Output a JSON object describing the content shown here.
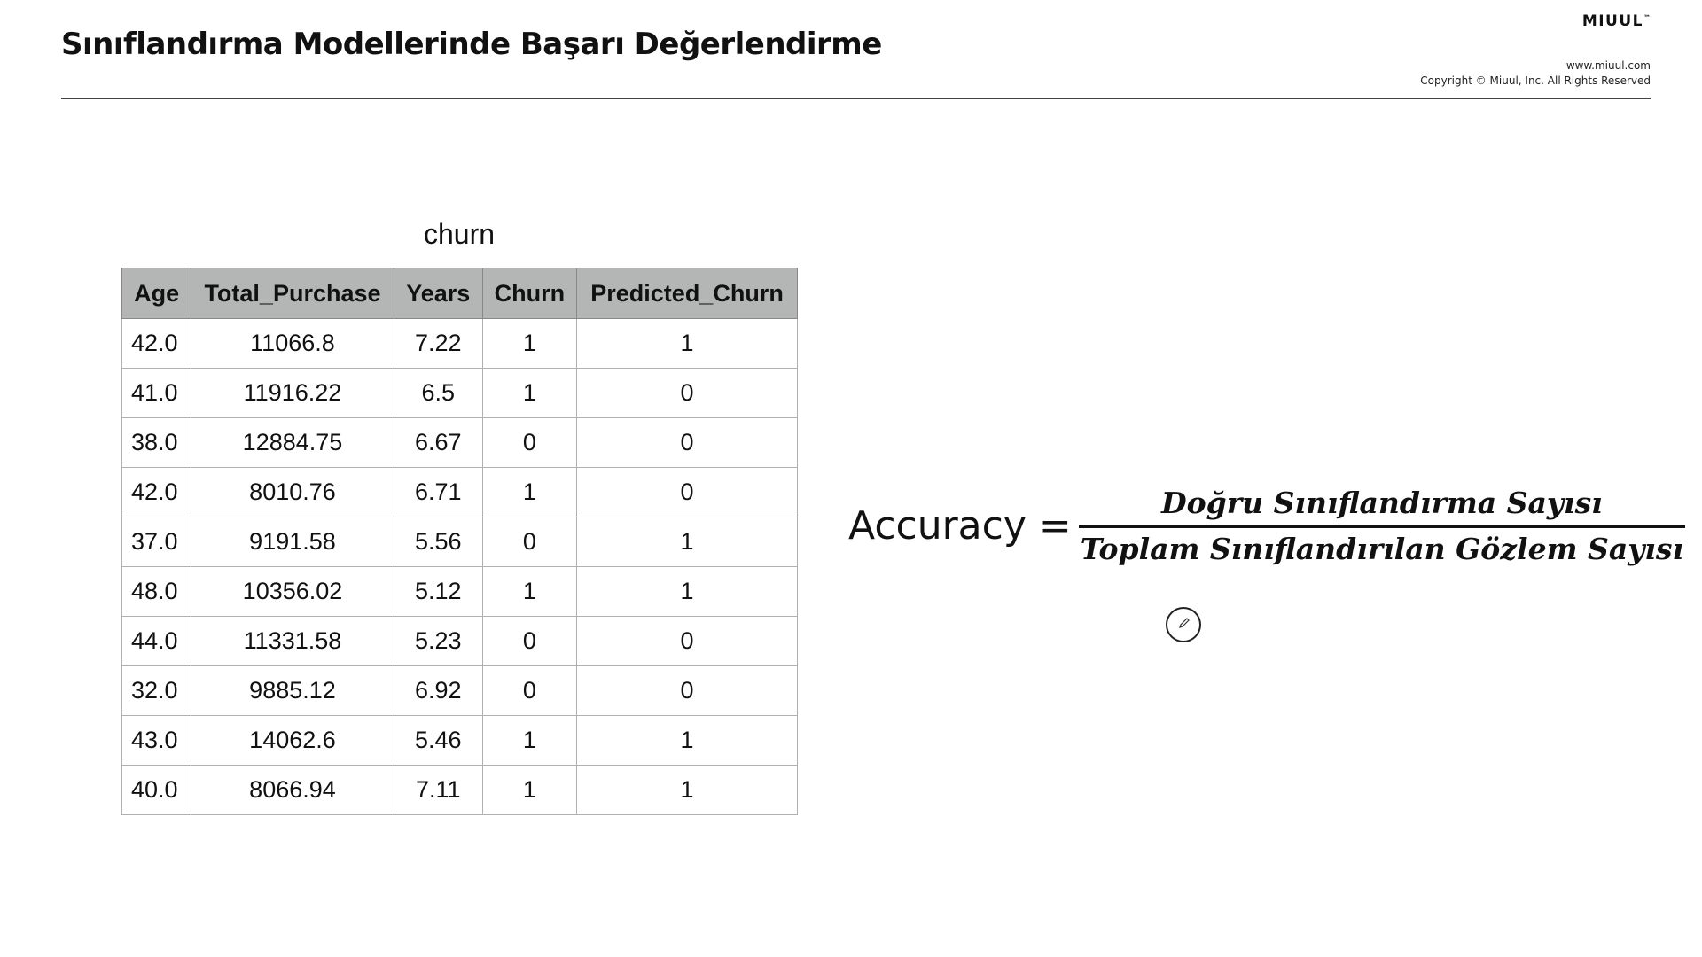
{
  "header": {
    "title": "Sınıflandırma Modellerinde Başarı Değerlendirme",
    "brand": "MIUUL",
    "brand_tm": "™",
    "website": "www.miuul.com",
    "copyright": "Copyright © Miuul, Inc. All Rights Reserved"
  },
  "table": {
    "caption": "churn",
    "columns": [
      "Age",
      "Total_Purchase",
      "Years",
      "Churn",
      "Predicted_Churn"
    ],
    "rows": [
      [
        "42.0",
        "11066.8",
        "7.22",
        "1",
        "1"
      ],
      [
        "41.0",
        "11916.22",
        "6.5",
        "1",
        "0"
      ],
      [
        "38.0",
        "12884.75",
        "6.67",
        "0",
        "0"
      ],
      [
        "42.0",
        "8010.76",
        "6.71",
        "1",
        "0"
      ],
      [
        "37.0",
        "9191.58",
        "5.56",
        "0",
        "1"
      ],
      [
        "48.0",
        "10356.02",
        "5.12",
        "1",
        "1"
      ],
      [
        "44.0",
        "11331.58",
        "5.23",
        "0",
        "0"
      ],
      [
        "32.0",
        "9885.12",
        "6.92",
        "0",
        "0"
      ],
      [
        "43.0",
        "14062.6",
        "5.46",
        "1",
        "1"
      ],
      [
        "40.0",
        "8066.94",
        "7.11",
        "1",
        "1"
      ]
    ]
  },
  "formula": {
    "label": "Accuracy =",
    "numerator": "Doğru Sınıflandırma Sayısı",
    "denominator": "Toplam Sınıflandırılan Gözlem Sayısı"
  },
  "icons": {
    "cursor": "pen-cursor-icon"
  }
}
